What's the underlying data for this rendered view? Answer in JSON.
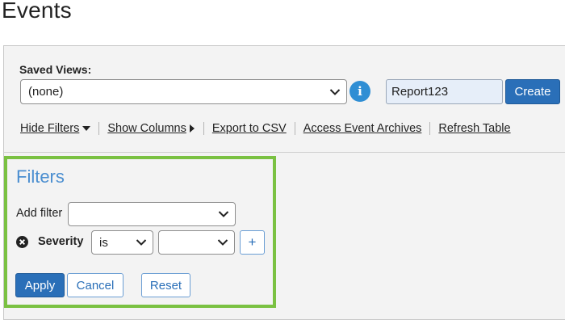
{
  "page": {
    "title": "Events"
  },
  "saved_views": {
    "label": "Saved Views:",
    "selected": "(none)",
    "info_icon": "info-icon",
    "report_name_value": "Report123",
    "create_label": "Create"
  },
  "toolbar": {
    "items": [
      {
        "label": "Hide Filters",
        "icon": "caret-down-icon"
      },
      {
        "label": "Show Columns",
        "icon": "caret-right-icon"
      },
      {
        "label": "Export to CSV"
      },
      {
        "label": "Access Event Archives"
      },
      {
        "label": "Refresh Table"
      }
    ]
  },
  "filters": {
    "title": "Filters",
    "add_filter_label": "Add filter",
    "add_filter_value": "",
    "severity": {
      "label": "Severity",
      "operator": "is",
      "value": "",
      "add_label": "+"
    },
    "apply_label": "Apply",
    "cancel_label": "Cancel",
    "reset_label": "Reset"
  },
  "colors": {
    "accent": "#2a6fb8",
    "filters_border": "#7ac142",
    "filters_title": "#4a8ed0",
    "info": "#2f8ed4"
  }
}
